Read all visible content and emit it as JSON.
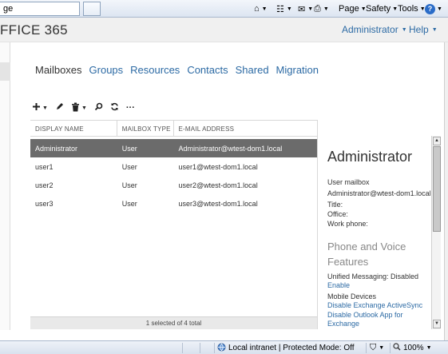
{
  "browser": {
    "tab_title": "ge",
    "commands": {
      "page": "Page",
      "safety": "Safety",
      "tools": "Tools"
    },
    "help_icon": "help-icon"
  },
  "header": {
    "brand": "FFICE 365",
    "user_menu": "Administrator",
    "help_menu": "Help"
  },
  "nav_tabs": [
    "Mailboxes",
    "Groups",
    "Resources",
    "Contacts",
    "Shared",
    "Migration"
  ],
  "active_tab": "Mailboxes",
  "toolbar": {
    "icons": [
      "add-icon",
      "edit-icon",
      "delete-icon",
      "search-icon",
      "refresh-icon",
      "more-icon"
    ],
    "more_label": "···"
  },
  "mailbox_list": {
    "columns": [
      "DISPLAY NAME",
      "MAILBOX TYPE",
      "E-MAIL ADDRESS"
    ],
    "rows": [
      {
        "name": "Administrator",
        "type": "User",
        "email": "Administrator@wtest-dom1.local",
        "selected": true
      },
      {
        "name": "user1",
        "type": "User",
        "email": "user1@wtest-dom1.local",
        "selected": false
      },
      {
        "name": "user2",
        "type": "User",
        "email": "user2@wtest-dom1.local",
        "selected": false
      },
      {
        "name": "user3",
        "type": "User",
        "email": "user3@wtest-dom1.local",
        "selected": false
      }
    ],
    "footer": "1 selected of 4 total"
  },
  "details": {
    "name": "Administrator",
    "kind": "User mailbox",
    "email": "Administrator@wtest-dom1.local",
    "title_label": "Title:",
    "office_label": "Office:",
    "work_phone_label": "Work phone:",
    "section_heading_1": "Phone and Voice",
    "section_heading_2": "Features",
    "um_status": "Unified Messaging: Disabled",
    "um_link": "Enable",
    "mobile_heading": "Mobile Devices",
    "mobile_link_1": "Disable Exchange ActiveSync",
    "mobile_link_2a": "Disable Outlook App for",
    "mobile_link_2b": "Exchange"
  },
  "status_bar": {
    "zone": "Local intranet | Protected Mode: Off",
    "zoom": "100%"
  },
  "colors": {
    "link": "#2c6aa4",
    "selected_row": "#6b6b6b"
  }
}
